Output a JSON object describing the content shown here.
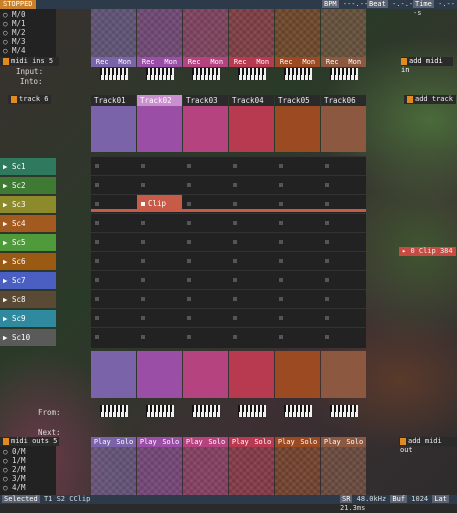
{
  "app": {
    "status": "STOPPED",
    "bpm_label": "BPM",
    "bpm_value": "---.---",
    "beat_label": "Beat",
    "beat_value": "-.-.--",
    "time_label": "Time",
    "time_value": "-.---s"
  },
  "midi_inputs": {
    "list": [
      "M/0",
      "M/1",
      "M/2",
      "M/3",
      "M/4"
    ],
    "count_label": "midi ins 5",
    "add_label": "add midi in",
    "input_label": "Input:",
    "into_label": "Into:"
  },
  "tracks": {
    "count_label": "track 6",
    "add_label": "add track",
    "items": [
      {
        "name": "Track01",
        "color": "#7a63a8",
        "rec": "Rec",
        "mon": "Mon",
        "play": "Play",
        "solo": "Solo"
      },
      {
        "name": "Track02",
        "color": "#9a4ea6",
        "rec": "Rec",
        "mon": "Mon",
        "play": "Play",
        "solo": "Solo"
      },
      {
        "name": "Track03",
        "color": "#b5437f",
        "rec": "Rec",
        "mon": "Mon",
        "play": "Play",
        "solo": "Solo"
      },
      {
        "name": "Track04",
        "color": "#b83a50",
        "rec": "Rec",
        "mon": "Mon",
        "play": "Play",
        "solo": "Solo"
      },
      {
        "name": "Track05",
        "color": "#9b4a22",
        "rec": "Rec",
        "mon": "Mon",
        "play": "Play",
        "solo": "Solo"
      },
      {
        "name": "Track06",
        "color": "#8c5840",
        "rec": "Rec",
        "mon": "Mon",
        "play": "Play",
        "solo": "Solo"
      }
    ]
  },
  "scenes": [
    {
      "name": "Sc1",
      "color": "#2f7a5f"
    },
    {
      "name": "Sc2",
      "color": "#3f7a35"
    },
    {
      "name": "Sc3",
      "color": "#8d8a2c"
    },
    {
      "name": "Sc4",
      "color": "#a35a1e"
    },
    {
      "name": "Sc5",
      "color": "#4f9a3a"
    },
    {
      "name": "Sc6",
      "color": "#9a5a14"
    },
    {
      "name": "Sc7",
      "color": "#4b5fc2"
    },
    {
      "name": "Sc8",
      "color": "#5a4a35"
    },
    {
      "name": "Sc9",
      "color": "#2f8aa0"
    },
    {
      "name": "Sc10",
      "color": "#5a5a5a"
    }
  ],
  "clip": {
    "label": "Clip",
    "color": "#c85a48"
  },
  "playhead_indicator": "0 Clip 384",
  "routing": {
    "from_label": "From:",
    "next_label": "Next:"
  },
  "midi_outputs": {
    "count_label": "midi outs 5",
    "add_label": "add midi out",
    "list": [
      "0/M",
      "1/M",
      "2/M",
      "3/M",
      "4/M"
    ]
  },
  "statusbar": {
    "selected_label": "Selected",
    "selected_value": "T1 S2 CClip",
    "sr_label": "SR",
    "sr_value": "48.0kHz",
    "buf_label": "Buf",
    "buf_value": "1024",
    "lat_label": "Lat",
    "lat_value": "21.3ms"
  }
}
